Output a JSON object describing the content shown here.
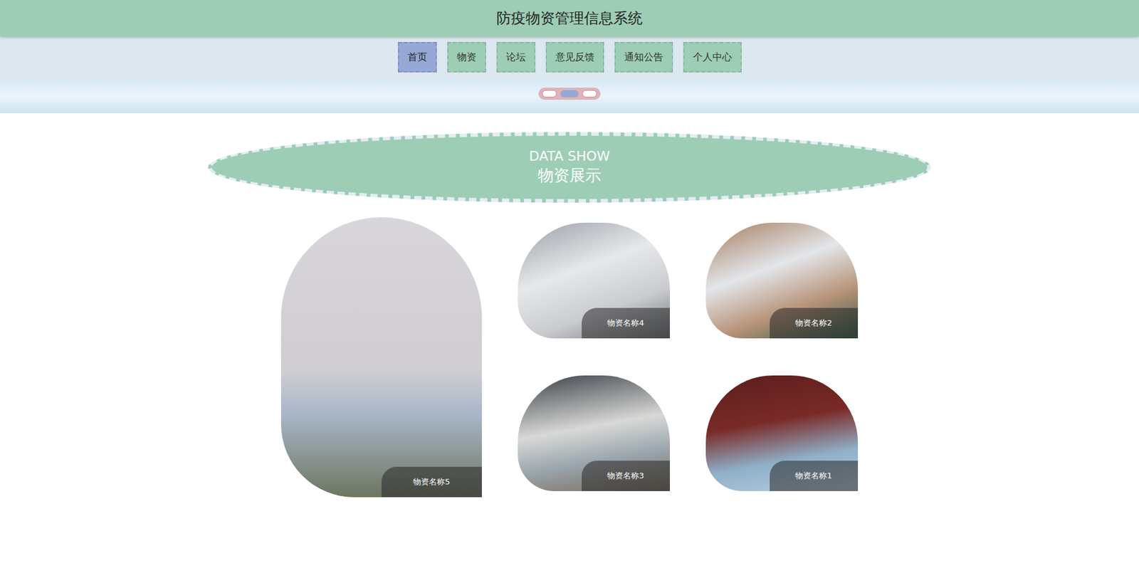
{
  "header": {
    "title": "防疫物资管理信息系统"
  },
  "nav": [
    {
      "label": "首页",
      "selected": true
    },
    {
      "label": "物资",
      "selected": false
    },
    {
      "label": "论坛",
      "selected": false
    },
    {
      "label": "意见反馈",
      "selected": false
    },
    {
      "label": "通知公告",
      "selected": false
    },
    {
      "label": "个人中心",
      "selected": false
    }
  ],
  "carousel": {
    "dots": [
      {
        "selected": false
      },
      {
        "selected": true
      },
      {
        "selected": false
      }
    ]
  },
  "section": {
    "title_en": "DATA SHOW",
    "title_zh": "物资展示"
  },
  "products": [
    {
      "name": "物资名称5",
      "kind": "large"
    },
    {
      "name": "物资名称4",
      "kind": "small"
    },
    {
      "name": "物资名称2",
      "kind": "small"
    },
    {
      "name": "物资名称3",
      "kind": "small"
    },
    {
      "name": "物资名称1",
      "kind": "small"
    }
  ]
}
